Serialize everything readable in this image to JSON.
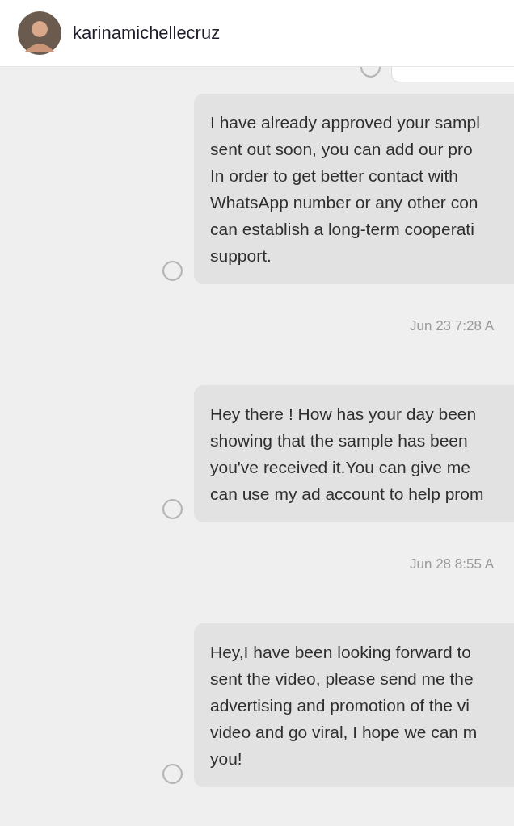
{
  "header": {
    "username": "karinamichellecruz"
  },
  "items": [
    {
      "kind": "partial"
    },
    {
      "kind": "message",
      "lines": [
        "I have already approved your sampl",
        "sent out soon, you can add our pro",
        "In order to get better contact with",
        "WhatsApp number or any other con",
        "can establish a long-term cooperati",
        "support."
      ]
    },
    {
      "kind": "timestamp",
      "text": "Jun 23 7:28 A"
    },
    {
      "kind": "message",
      "lines": [
        "Hey there ! How has your day been",
        "showing that the sample has been",
        "you've received it.You can give me",
        "can use my ad account to help prom"
      ]
    },
    {
      "kind": "timestamp",
      "text": "Jun 28 8:55 A"
    },
    {
      "kind": "message",
      "lines": [
        "Hey,I have been looking forward to",
        "sent the video, please send me the",
        "advertising and promotion of the vi",
        "video and go viral, I hope we can m",
        "you!"
      ]
    }
  ]
}
